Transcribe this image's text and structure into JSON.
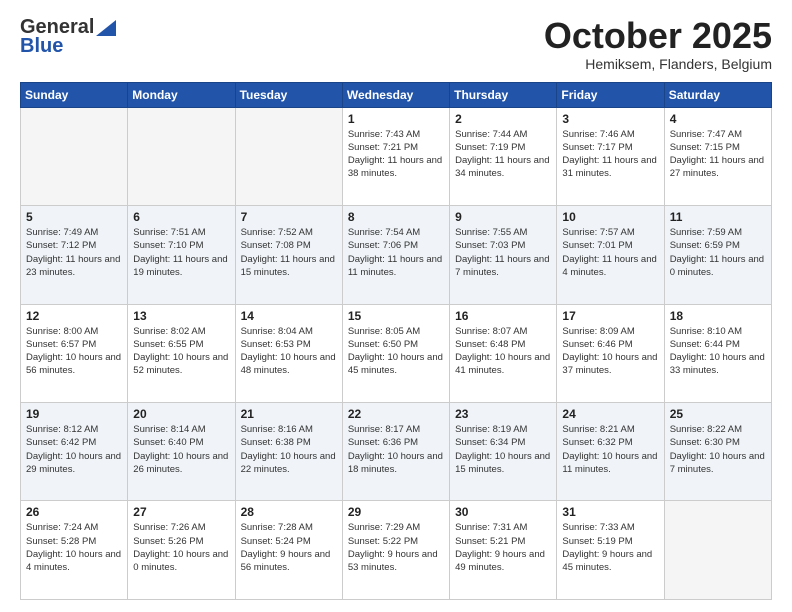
{
  "header": {
    "logo_general": "General",
    "logo_blue": "Blue",
    "title": "October 2025",
    "subtitle": "Hemiksem, Flanders, Belgium"
  },
  "days_of_week": [
    "Sunday",
    "Monday",
    "Tuesday",
    "Wednesday",
    "Thursday",
    "Friday",
    "Saturday"
  ],
  "weeks": [
    [
      {
        "day": "",
        "empty": true
      },
      {
        "day": "",
        "empty": true
      },
      {
        "day": "",
        "empty": true
      },
      {
        "day": "1",
        "sunrise": "7:43 AM",
        "sunset": "7:21 PM",
        "daylight": "11 hours and 38 minutes."
      },
      {
        "day": "2",
        "sunrise": "7:44 AM",
        "sunset": "7:19 PM",
        "daylight": "11 hours and 34 minutes."
      },
      {
        "day": "3",
        "sunrise": "7:46 AM",
        "sunset": "7:17 PM",
        "daylight": "11 hours and 31 minutes."
      },
      {
        "day": "4",
        "sunrise": "7:47 AM",
        "sunset": "7:15 PM",
        "daylight": "11 hours and 27 minutes."
      }
    ],
    [
      {
        "day": "5",
        "sunrise": "7:49 AM",
        "sunset": "7:12 PM",
        "daylight": "11 hours and 23 minutes."
      },
      {
        "day": "6",
        "sunrise": "7:51 AM",
        "sunset": "7:10 PM",
        "daylight": "11 hours and 19 minutes."
      },
      {
        "day": "7",
        "sunrise": "7:52 AM",
        "sunset": "7:08 PM",
        "daylight": "11 hours and 15 minutes."
      },
      {
        "day": "8",
        "sunrise": "7:54 AM",
        "sunset": "7:06 PM",
        "daylight": "11 hours and 11 minutes."
      },
      {
        "day": "9",
        "sunrise": "7:55 AM",
        "sunset": "7:03 PM",
        "daylight": "11 hours and 7 minutes."
      },
      {
        "day": "10",
        "sunrise": "7:57 AM",
        "sunset": "7:01 PM",
        "daylight": "11 hours and 4 minutes."
      },
      {
        "day": "11",
        "sunrise": "7:59 AM",
        "sunset": "6:59 PM",
        "daylight": "11 hours and 0 minutes."
      }
    ],
    [
      {
        "day": "12",
        "sunrise": "8:00 AM",
        "sunset": "6:57 PM",
        "daylight": "10 hours and 56 minutes."
      },
      {
        "day": "13",
        "sunrise": "8:02 AM",
        "sunset": "6:55 PM",
        "daylight": "10 hours and 52 minutes."
      },
      {
        "day": "14",
        "sunrise": "8:04 AM",
        "sunset": "6:53 PM",
        "daylight": "10 hours and 48 minutes."
      },
      {
        "day": "15",
        "sunrise": "8:05 AM",
        "sunset": "6:50 PM",
        "daylight": "10 hours and 45 minutes."
      },
      {
        "day": "16",
        "sunrise": "8:07 AM",
        "sunset": "6:48 PM",
        "daylight": "10 hours and 41 minutes."
      },
      {
        "day": "17",
        "sunrise": "8:09 AM",
        "sunset": "6:46 PM",
        "daylight": "10 hours and 37 minutes."
      },
      {
        "day": "18",
        "sunrise": "8:10 AM",
        "sunset": "6:44 PM",
        "daylight": "10 hours and 33 minutes."
      }
    ],
    [
      {
        "day": "19",
        "sunrise": "8:12 AM",
        "sunset": "6:42 PM",
        "daylight": "10 hours and 29 minutes."
      },
      {
        "day": "20",
        "sunrise": "8:14 AM",
        "sunset": "6:40 PM",
        "daylight": "10 hours and 26 minutes."
      },
      {
        "day": "21",
        "sunrise": "8:16 AM",
        "sunset": "6:38 PM",
        "daylight": "10 hours and 22 minutes."
      },
      {
        "day": "22",
        "sunrise": "8:17 AM",
        "sunset": "6:36 PM",
        "daylight": "10 hours and 18 minutes."
      },
      {
        "day": "23",
        "sunrise": "8:19 AM",
        "sunset": "6:34 PM",
        "daylight": "10 hours and 15 minutes."
      },
      {
        "day": "24",
        "sunrise": "8:21 AM",
        "sunset": "6:32 PM",
        "daylight": "10 hours and 11 minutes."
      },
      {
        "day": "25",
        "sunrise": "8:22 AM",
        "sunset": "6:30 PM",
        "daylight": "10 hours and 7 minutes."
      }
    ],
    [
      {
        "day": "26",
        "sunrise": "7:24 AM",
        "sunset": "5:28 PM",
        "daylight": "10 hours and 4 minutes."
      },
      {
        "day": "27",
        "sunrise": "7:26 AM",
        "sunset": "5:26 PM",
        "daylight": "10 hours and 0 minutes."
      },
      {
        "day": "28",
        "sunrise": "7:28 AM",
        "sunset": "5:24 PM",
        "daylight": "9 hours and 56 minutes."
      },
      {
        "day": "29",
        "sunrise": "7:29 AM",
        "sunset": "5:22 PM",
        "daylight": "9 hours and 53 minutes."
      },
      {
        "day": "30",
        "sunrise": "7:31 AM",
        "sunset": "5:21 PM",
        "daylight": "9 hours and 49 minutes."
      },
      {
        "day": "31",
        "sunrise": "7:33 AM",
        "sunset": "5:19 PM",
        "daylight": "9 hours and 45 minutes."
      },
      {
        "day": "",
        "empty": true
      }
    ]
  ]
}
